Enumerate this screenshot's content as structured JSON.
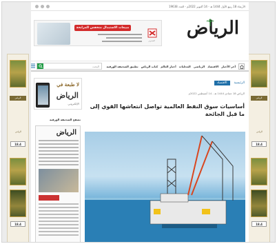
{
  "topbar": {
    "date": "الأربعاء 18 ربيع الأول 1444 هـ - 14 أكتوبر 2022م - العدد 19638"
  },
  "logo": {
    "text": "الرياض"
  },
  "banner": {
    "cta": "مبيعات الاستبدال منخفض المرابحة",
    "brand": "المصرف"
  },
  "nav": {
    "items": [
      "آخر الأخبار",
      "الاقتصاد",
      "الرياضي",
      "المحليات",
      "أخبار العالم",
      "كتاب الرياض",
      "تطبيق الصحيفة الورقية"
    ],
    "search_placeholder": "البحث"
  },
  "breadcrumb": {
    "home": "الرئيسية",
    "section": "الاقتصاد"
  },
  "article": {
    "meta": "الرياض 18 جمادى 1444 هـ - 14 أغسطس 2022م",
    "headline": "أساسيات سوق النفط العالمية تواصل انتعاشها القوي إلى ما قبل الجائحة"
  },
  "sidebar": {
    "promo_title": "لا طبعة في",
    "promo_brand": "الرياض",
    "promo_sub": "الإلكتروني",
    "label": "تصفح الصحيفة الورقية",
    "paper_masthead": "الرياض"
  },
  "side_ads": {
    "price": "18.4",
    "caption": "الرياض"
  },
  "colors": {
    "accent": "#1f6fa8",
    "search_button": "#1f9b44",
    "banner_cta": "#d32b2b"
  }
}
